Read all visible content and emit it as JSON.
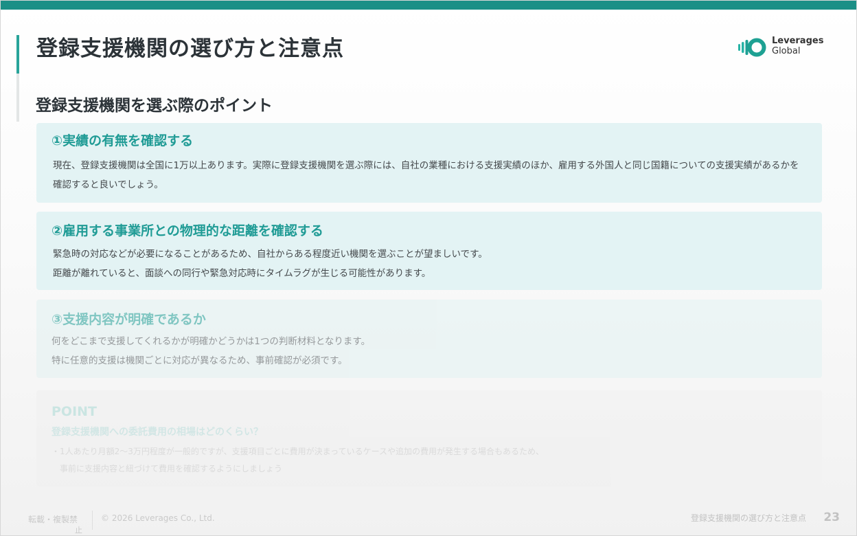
{
  "slide": {
    "title": "登録支援機関の選び方と注意点",
    "subtitle": "登録支援機関を選ぶ際のポイント",
    "accent_color": "#1a8f86"
  },
  "logo": {
    "line1": "Leverages",
    "line2": "Global",
    "icon": "leverages-logo-icon"
  },
  "points": [
    {
      "heading": "①実績の有無を確認する",
      "lines": [
        "現在、登録支援機関は全国に1万以上あります。実際に登録支援機関を選ぶ際には、自社の業種における支援実績のほか、雇用する外国人と同じ国籍につい",
        "ての支援実績があるかを確認すると良いでしょう。"
      ]
    },
    {
      "heading": "②雇用する事業所との物理的な距離を確認する",
      "lines": [
        "緊急時の対応などが必要になることがあるため、自社からある程度近い機関を選ぶことが望ましいです。",
        "距離が離れていると、面談への同行や緊急対応時にタイムラグが生じる可能性があります。"
      ]
    },
    {
      "heading": "③支援内容が明確であるか",
      "lines": [
        "何をどこまで支援してくれるかが明確かどうかは1つの判断材料となります。",
        "特に任意的支援は機関ごとに対応が異なるため、事前確認が必須です。"
      ]
    }
  ],
  "point_box": {
    "label": "POINT",
    "question": "登録支援機関への委託費用の相場はどのくらい？",
    "lines": [
      "・1人あたり月額2〜3万円程度が一般的ですが、支援項目ごとに費用が決まっているケースや追加の費用が発生する場合もあるため、",
      "事前に支援内容と紐づけて費用を確認するようにしましょう"
    ]
  },
  "footer": {
    "left": "転載・複製禁",
    "left2": "止",
    "copyright": "© 2026 Leverages Co., Ltd.",
    "right": "登録支援機関の選び方と注意点",
    "page": "23"
  }
}
